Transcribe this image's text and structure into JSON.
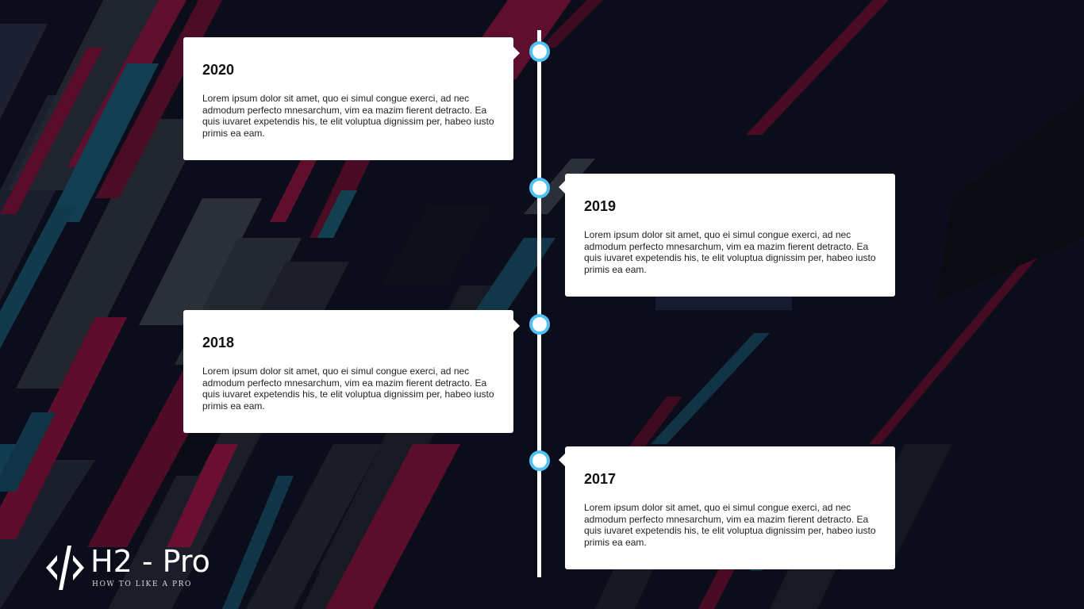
{
  "watermark": {
    "text": ""
  },
  "timeline": {
    "events": [
      {
        "year": "2020",
        "text": "Lorem ipsum dolor sit amet, quo ei simul congue exerci, ad nec admodum perfecto mnesarchum, vim ea mazim fierent detracto. Ea quis iuvaret expetendis his, te elit voluptua dignissim per, habeo iusto primis ea eam."
      },
      {
        "year": "2019",
        "text": "Lorem ipsum dolor sit amet, quo ei simul congue exerci, ad nec admodum perfecto mnesarchum, vim ea mazim fierent detracto. Ea quis iuvaret expetendis his, te elit voluptua dignissim per, habeo iusto primis ea eam."
      },
      {
        "year": "2018",
        "text": "Lorem ipsum dolor sit amet, quo ei simul congue exerci, ad nec admodum perfecto mnesarchum, vim ea mazim fierent detracto. Ea quis iuvaret expetendis his, te elit voluptua dignissim per, habeo iusto primis ea eam."
      },
      {
        "year": "2017",
        "text": "Lorem ipsum dolor sit amet, quo ei simul congue exerci, ad nec admodum perfecto mnesarchum, vim ea mazim fierent detracto. Ea quis iuvaret expetendis his, te elit voluptua dignissim per, habeo iusto primis ea eam."
      }
    ]
  },
  "logo": {
    "title": "H2 - Pro",
    "subtitle": "HOW TO LIKE A PRO",
    "icon": "code-brackets-icon"
  },
  "colors": {
    "background": "#0c0d1b",
    "accent_crimson": "#6b0f2e",
    "accent_teal": "#123e52",
    "dot_border": "#4fc1f5",
    "card_bg": "#ffffff",
    "line": "#ffffff"
  }
}
